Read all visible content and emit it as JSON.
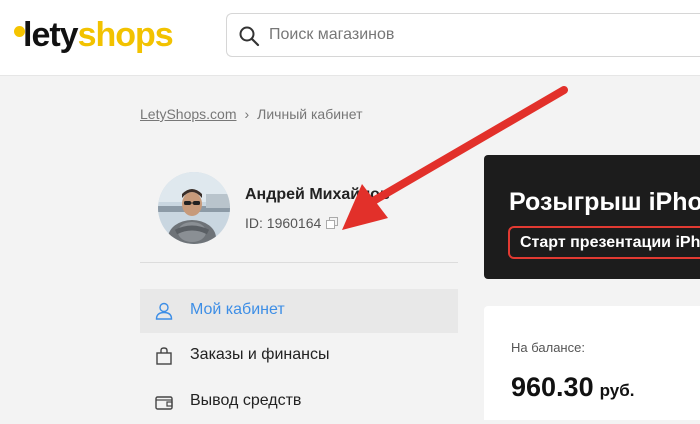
{
  "header": {
    "logo_part1": "lety",
    "logo_part2": "shops",
    "search_placeholder": "Поиск магазинов"
  },
  "breadcrumb": {
    "home": "LetyShops.com",
    "separator": "›",
    "current": "Личный кабинет"
  },
  "profile": {
    "name": "Андрей Михайлов",
    "id_text": "ID: 1960164"
  },
  "menu": [
    {
      "label": "Мой кабинет",
      "icon": "user-icon",
      "active": true
    },
    {
      "label": "Заказы и финансы",
      "icon": "bag-icon",
      "active": false
    },
    {
      "label": "Вывод средств",
      "icon": "wallet-icon",
      "active": false
    }
  ],
  "promo": {
    "title": "Розыгрыш iPhone",
    "button": "Старт презентации iPhone"
  },
  "balance": {
    "label": "На балансе:",
    "amount": "960.30",
    "currency": "руб."
  },
  "colors": {
    "brand_yellow": "#f2c200",
    "accent_blue": "#3d8ee6",
    "arrow_red": "#e2302a",
    "promo_bg": "#1c1c1c"
  }
}
